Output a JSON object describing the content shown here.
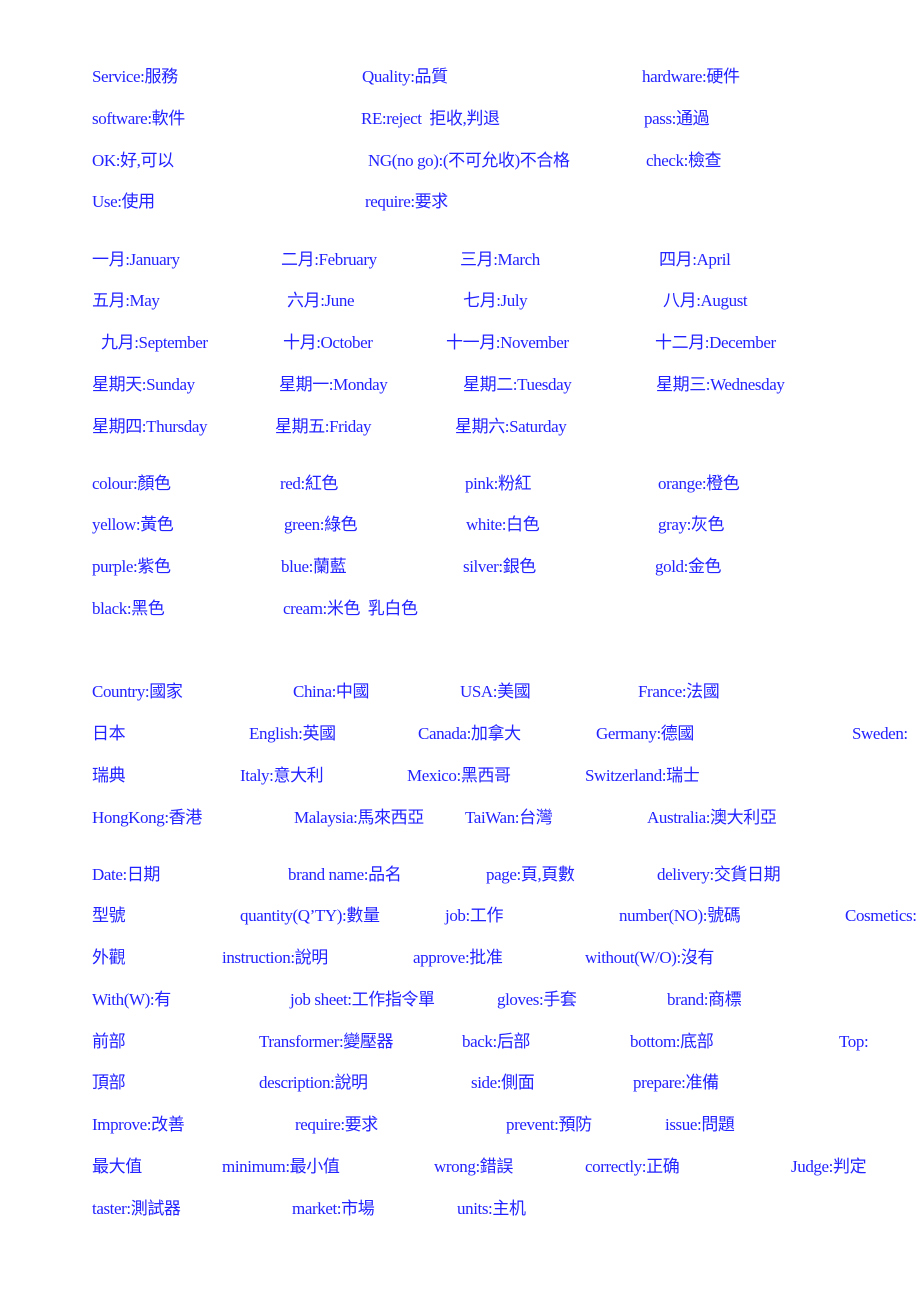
{
  "text_color": "#2323ff",
  "rows": [
    [
      "Service:服務",
      "Quality:品質",
      "hardware:硬件"
    ],
    [
      "software:軟件",
      "RE:reject  拒收,判退",
      "pass:通過"
    ],
    [
      "OK:好,可以",
      "NG(no go):(不可允收)不合格",
      "check:檢查"
    ],
    [
      "Use:使用",
      "require:要求"
    ],
    [
      "一月:January",
      "二月:February",
      "三月:March",
      "四月:April"
    ],
    [
      "五月:May",
      "六月:June",
      "七月:July",
      "八月:August"
    ],
    [
      "九月:September",
      "十月:October",
      "十一月:November",
      "十二月:December"
    ],
    [
      "星期天:Sunday",
      "星期一:Monday",
      "星期二:Tuesday",
      "星期三:Wednesday"
    ],
    [
      "星期四:Thursday",
      "星期五:Friday",
      "星期六:Saturday"
    ],
    [
      "colour:顏色",
      "red:紅色",
      "pink:粉紅",
      "orange:橙色"
    ],
    [
      "yellow:黃色",
      "green:綠色",
      "white:白色",
      "gray:灰色"
    ],
    [
      "purple:紫色",
      "blue:蘭藍",
      "silver:銀色",
      "gold:金色"
    ],
    [
      "black:黑色",
      "cream:米色  乳白色"
    ],
    [
      "Country:國家",
      "China:中國",
      "USA:美國",
      "France:法國"
    ],
    [
      "日本",
      "English:英國",
      "Canada:加拿大",
      "Germany:德國",
      "Sweden:"
    ],
    [
      "瑞典",
      "Italy:意大利",
      "Mexico:黑西哥",
      "Switzerland:瑞士"
    ],
    [
      "HongKong:香港",
      "Malaysia:馬來西亞",
      "TaiWan:台灣",
      "Australia:澳大利亞"
    ],
    [
      "Date:日期",
      "brand name:品名",
      "page:頁,頁數",
      "delivery:交貨日期"
    ],
    [
      "型號",
      "quantity(Q’TY):數量",
      "job:工作",
      "number(NO):號碼",
      "Cosmetics:"
    ],
    [
      "外觀",
      "instruction:說明",
      "approve:批准",
      "without(W/O):沒有"
    ],
    [
      "With(W):有",
      "job sheet:工作指令單",
      "gloves:手套",
      "brand:商標"
    ],
    [
      "前部",
      "Transformer:變壓器",
      "back:后部",
      "bottom:底部",
      "Top:"
    ],
    [
      "頂部",
      "description:說明",
      "side:側面",
      "prepare:准備"
    ],
    [
      "Improve:改善",
      "require:要求",
      "prevent:預防",
      "issue:問題"
    ],
    [
      "最大值",
      "minimum:最小值",
      "wrong:錯誤",
      "correctly:正确",
      "Judge:判定"
    ],
    [
      "taster:測試器",
      "market:市場",
      "units:主机"
    ]
  ]
}
